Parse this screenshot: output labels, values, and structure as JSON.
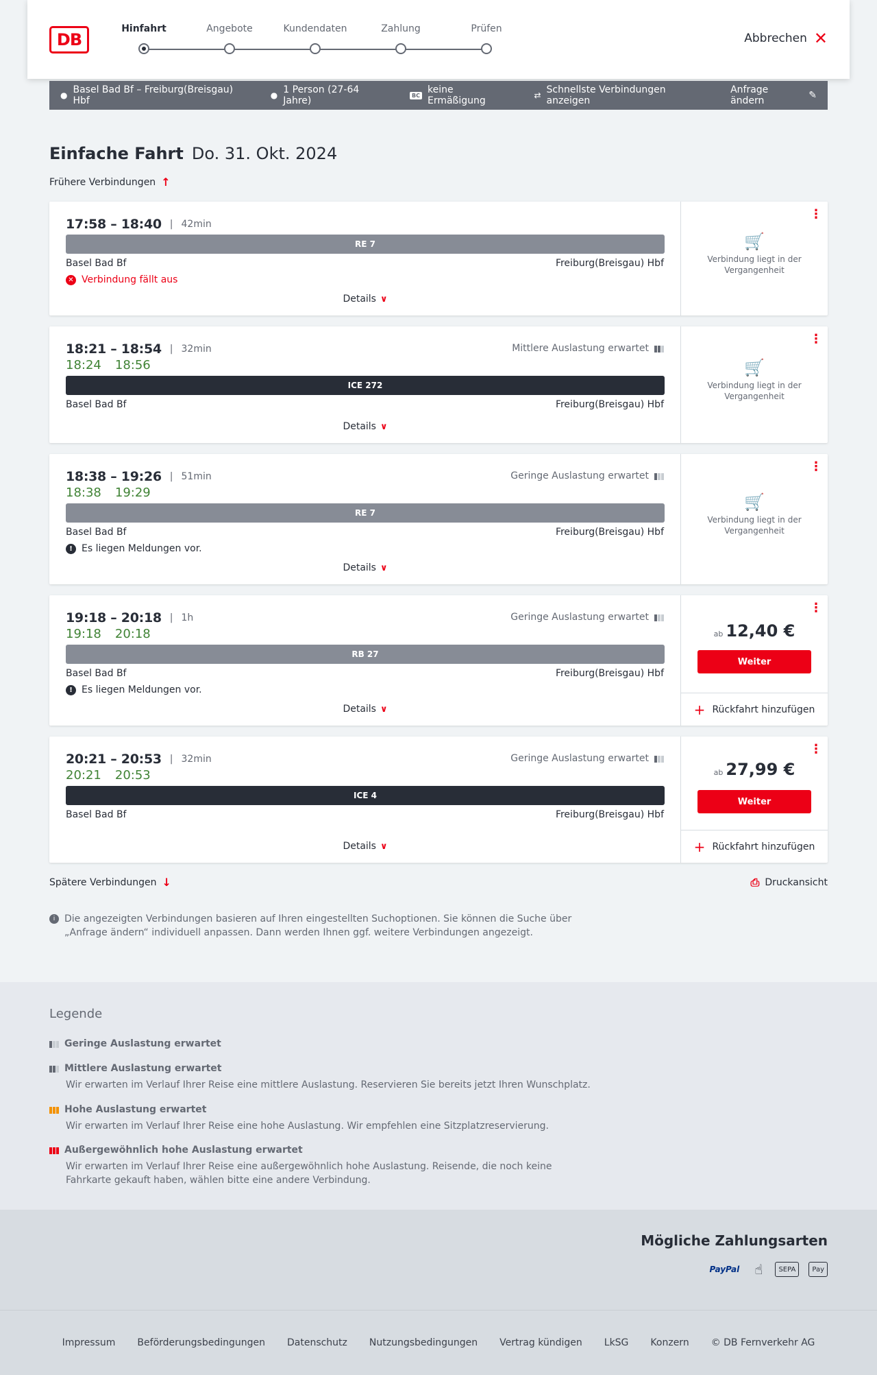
{
  "header": {
    "logo_text": "DB",
    "steps": [
      {
        "label": "Hinfahrt"
      },
      {
        "label": "Angebote"
      },
      {
        "label": "Kundendaten"
      },
      {
        "label": "Zahlung"
      },
      {
        "label": "Prüfen"
      }
    ],
    "cancel_label": "Abbrechen"
  },
  "summary": {
    "route": "Basel Bad Bf – Freiburg(Breisgau) Hbf",
    "persons": "1 Person (27-64 Jahre)",
    "bc_badge": "BC",
    "discount": "keine Ermäßigung",
    "fastest": "Schnellste Verbindungen anzeigen",
    "edit": "Anfrage ändern"
  },
  "title": {
    "trip_type": "Einfache Fahrt",
    "date": "Do. 31. Okt. 2024"
  },
  "earlier": "Frühere Verbindungen",
  "later": "Spätere Verbindungen",
  "print": "Druckansicht",
  "details_label": "Details",
  "past_text": "Verbindung liegt in der Vergangenheit",
  "ab_label": "ab",
  "weiter_label": "Weiter",
  "return_label": "Rückfahrt hinzufügen",
  "connections": [
    {
      "times": "17:58 – 18:40",
      "duration": "42min",
      "train": "RE 7",
      "from": "Basel Bad Bf",
      "to": "Freiburg(Breisgau) Hbf",
      "message": "Verbindung fällt aus",
      "message_type": "cancelled",
      "state": "past"
    },
    {
      "times": "18:21 – 18:54",
      "duration": "32min",
      "rt_dep": "18:24",
      "rt_arr": "18:56",
      "occupancy": "Mittlere Auslastung erwartet",
      "train": "ICE 272",
      "from": "Basel Bad Bf",
      "to": "Freiburg(Breisgau) Hbf",
      "state": "past"
    },
    {
      "times": "18:38 – 19:26",
      "duration": "51min",
      "rt_dep": "18:38",
      "rt_arr": "19:29",
      "occupancy": "Geringe Auslastung erwartet",
      "train": "RE 7",
      "from": "Basel Bad Bf",
      "to": "Freiburg(Breisgau) Hbf",
      "message": "Es liegen Meldungen vor.",
      "state": "past"
    },
    {
      "times": "19:18 – 20:18",
      "duration": "1h",
      "rt_dep": "19:18",
      "rt_arr": "20:18",
      "occupancy": "Geringe Auslastung erwartet",
      "train": "RB 27",
      "from": "Basel Bad Bf",
      "to": "Freiburg(Breisgau) Hbf",
      "message": "Es liegen Meldungen vor.",
      "price": "12,40 €"
    },
    {
      "times": "20:21 – 20:53",
      "duration": "32min",
      "rt_dep": "20:21",
      "rt_arr": "20:53",
      "occupancy": "Geringe Auslastung erwartet",
      "train": "ICE 4",
      "from": "Basel Bad Bf",
      "to": "Freiburg(Breisgau) Hbf",
      "price": "27,99 €"
    }
  ],
  "info_text": "Die angezeigten Verbindungen basieren auf Ihren eingestellten Suchoptionen. Sie können die Suche über „Anfrage ändern“ individuell anpassen. Dann werden Ihnen ggf. weitere Verbindungen angezeigt.",
  "legend": {
    "title": "Legende",
    "items": [
      {
        "title": "Geringe Auslastung erwartet",
        "text": ""
      },
      {
        "title": "Mittlere Auslastung erwartet",
        "text": "Wir erwarten im Verlauf Ihrer Reise eine mittlere Auslastung. Reservieren Sie bereits jetzt Ihren Wunschplatz."
      },
      {
        "title": "Hohe Auslastung erwartet",
        "text": "Wir erwarten im Verlauf Ihrer Reise eine hohe Auslastung. Wir empfehlen eine Sitzplatzreservierung."
      },
      {
        "title": "Außergewöhnlich hohe Auslastung erwartet",
        "text": "Wir erwarten im Verlauf Ihrer Reise eine außergewöhnlich hohe Auslastung. Reisende, die noch keine Fahrkarte gekauft haben, wählen bitte eine andere Verbindung."
      }
    ],
    "colors": {
      "low": "#646973",
      "mid": "#646973",
      "high": "#f39200",
      "extreme": "#ec0016"
    }
  },
  "payment": {
    "title": "Mögliche Zahlungsarten",
    "methods": [
      "PayPal",
      "SEPA",
      "Pay"
    ],
    "icons": [
      "paypal-icon",
      "giro-icon",
      "sepa-icon",
      "apple-pay-icon"
    ]
  },
  "footer": {
    "links": [
      "Impressum",
      "Beförderungsbedingungen",
      "Datenschutz",
      "Nutzungsbedingungen",
      "Vertrag kündigen",
      "LkSG",
      "Konzern",
      "© DB Fernverkehr AG"
    ]
  },
  "colors": {
    "brand": "#ec0016",
    "realtime": "#408335",
    "regional_train": "#878c96",
    "ice_train": "#282d37"
  }
}
